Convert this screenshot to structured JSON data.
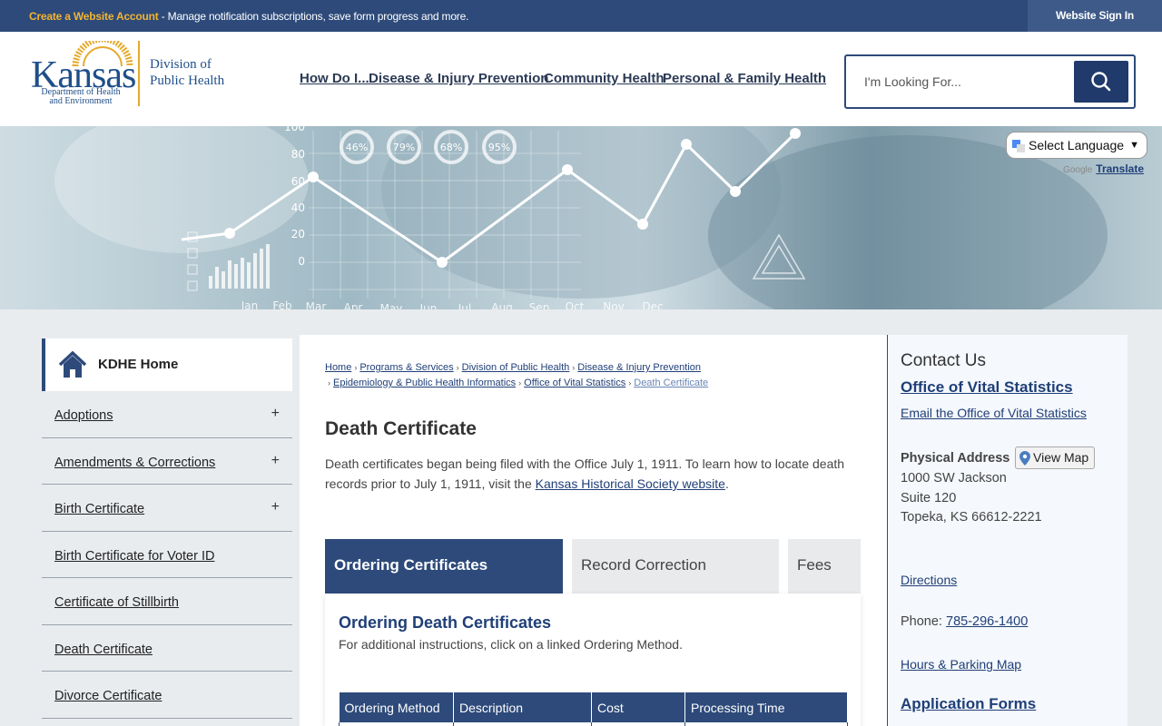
{
  "topbar": {
    "create_account": "Create a Website Account",
    "promo_text": " - Manage notification subscriptions, save form progress and more.",
    "sign_in": "Website Sign In"
  },
  "logo": {
    "kansas": "Kansas",
    "dept_line1": "Department of Health",
    "dept_line2": "and Environment",
    "division_line1": "Division of",
    "division_line2": "Public Health"
  },
  "nav": {
    "items": [
      "How Do I...",
      "Disease & Injury Prevention",
      "Community Health",
      "Personal & Family Health"
    ]
  },
  "search": {
    "placeholder": "I'm Looking For..."
  },
  "translate": {
    "select_language": "Select Language",
    "powered_by": "Google",
    "translate_link": "Translate"
  },
  "banner": {
    "y_ticks": [
      "100",
      "80",
      "60",
      "40",
      "20",
      "0"
    ],
    "months": [
      "Jan",
      "Feb",
      "Mar",
      "Apr",
      "May",
      "Jun",
      "Jul",
      "Aug",
      "Sep",
      "Oct",
      "Nov",
      "Dec"
    ],
    "circles": [
      "46%",
      "79%",
      "68%",
      "95%"
    ]
  },
  "sidebar": {
    "home": "KDHE Home",
    "items": [
      {
        "label": "Adoptions",
        "expandable": true
      },
      {
        "label": "Amendments & Corrections",
        "expandable": true
      },
      {
        "label": "Birth Certificate",
        "expandable": true
      },
      {
        "label": "Birth Certificate for Voter ID",
        "expandable": false
      },
      {
        "label": "Certificate of Stillbirth",
        "expandable": false
      },
      {
        "label": "Death Certificate",
        "expandable": false
      },
      {
        "label": "Divorce Certificate",
        "expandable": false
      }
    ],
    "plus_symbol": "+"
  },
  "breadcrumb": {
    "items": [
      "Home",
      "Programs & Services",
      "Division of Public Health",
      "Disease & Injury Prevention",
      "Epidemiology & Public Health Informatics",
      "Office of Vital Statistics"
    ],
    "current": "Death Certificate",
    "separator": "›"
  },
  "page": {
    "title": "Death Certificate",
    "intro_before": "Death certificates began being filed with the Office July 1, 1911. To learn how to locate death records prior to July 1, 1911, visit the ",
    "intro_link": "Kansas Historical Society website",
    "intro_after": "."
  },
  "tabs": [
    "Ordering Certificates",
    "Record Correction",
    "Fees"
  ],
  "panel": {
    "heading": "Ordering Death Certificates",
    "description": "For additional instructions, click on a linked Ordering Method.",
    "table_headers": [
      "Ordering Method",
      "Description",
      "Cost",
      "Processing Time"
    ]
  },
  "contact": {
    "title": "Contact Us",
    "office": "Office of Vital Statistics",
    "email": "Email the Office of Vital Statistics",
    "physical_address_label": "Physical Address",
    "view_map": "View Map",
    "address": [
      "1000 SW Jackson",
      "Suite 120",
      "Topeka, KS 66612-2221"
    ],
    "directions": "Directions",
    "phone_label": "Phone: ",
    "phone": "785-296-1400",
    "hours": "Hours & Parking Map",
    "forms": "Application Forms"
  }
}
